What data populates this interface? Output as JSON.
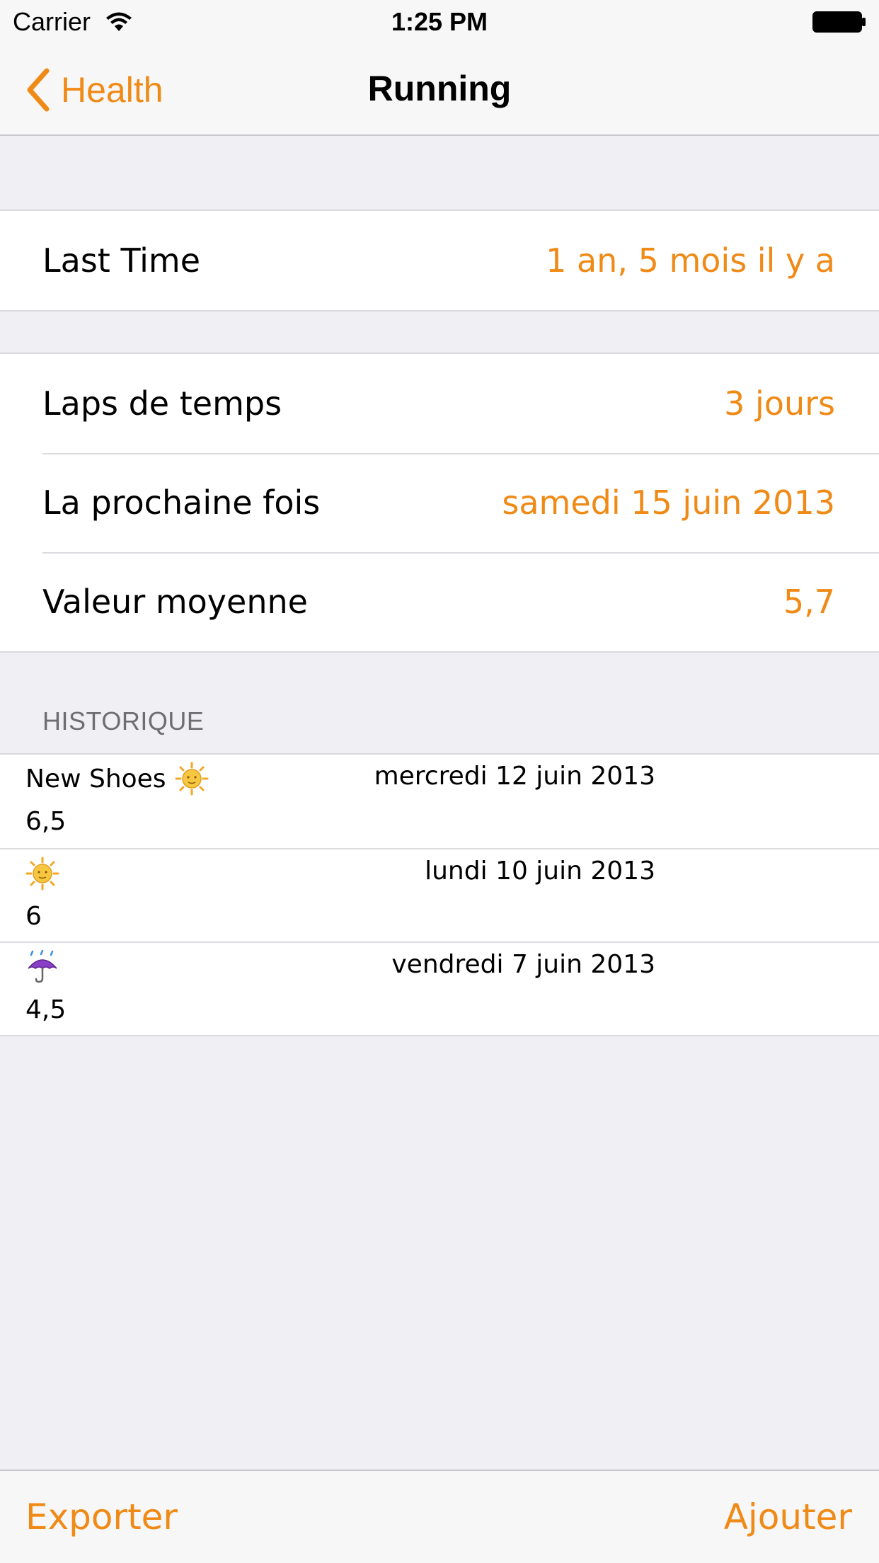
{
  "status_bar": {
    "carrier": "Carrier",
    "time": "1:25 PM"
  },
  "nav": {
    "back_label": "Health",
    "title": "Running"
  },
  "summary": {
    "last_time": {
      "label": "Last Time",
      "value": "1 an, 5 mois il y a"
    }
  },
  "details": [
    {
      "label": "Laps de temps",
      "value": "3 jours"
    },
    {
      "label": "La prochaine fois",
      "value": "samedi 15 juin 2013"
    },
    {
      "label": "Valeur moyenne",
      "value": "5,7"
    }
  ],
  "history": {
    "header": "HISTORIQUE",
    "items": [
      {
        "note": "New Shoes",
        "icon": "sun-emoji-icon",
        "date": "mercredi 12 juin 2013",
        "value": "6,5"
      },
      {
        "note": "",
        "icon": "sun-emoji-icon",
        "date": "lundi 10 juin 2013",
        "value": "6"
      },
      {
        "note": "",
        "icon": "umbrella-rain-emoji-icon",
        "date": "vendredi 7 juin 2013",
        "value": "4,5"
      }
    ]
  },
  "toolbar": {
    "export_label": "Exporter",
    "add_label": "Ajouter"
  },
  "colors": {
    "accent": "#f08a17",
    "background": "#efeff4",
    "bar": "#f7f7f7"
  }
}
